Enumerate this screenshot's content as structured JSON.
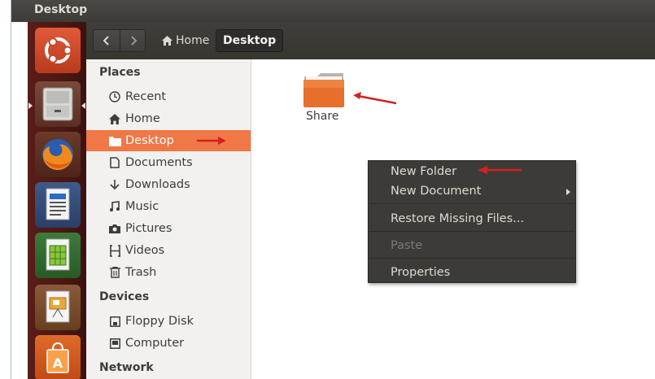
{
  "window": {
    "title": "Desktop"
  },
  "toolbar": {
    "back_icon": "chevron-left-icon",
    "forward_icon": "chevron-right-icon",
    "breadcrumb_home": "Home",
    "breadcrumb_current": "Desktop"
  },
  "launcher": {
    "items": [
      "ubuntu-dash",
      "files",
      "firefox",
      "libreoffice-writer",
      "libreoffice-calc",
      "libreoffice-impress",
      "software-center"
    ]
  },
  "sidebar": {
    "places_title": "Places",
    "places": [
      {
        "label": "Recent",
        "icon": "clock-icon"
      },
      {
        "label": "Home",
        "icon": "home-icon"
      },
      {
        "label": "Desktop",
        "icon": "folder-icon",
        "active": true
      },
      {
        "label": "Documents",
        "icon": "document-icon"
      },
      {
        "label": "Downloads",
        "icon": "download-icon"
      },
      {
        "label": "Music",
        "icon": "music-icon"
      },
      {
        "label": "Pictures",
        "icon": "camera-icon"
      },
      {
        "label": "Videos",
        "icon": "film-icon"
      },
      {
        "label": "Trash",
        "icon": "trash-icon"
      }
    ],
    "devices_title": "Devices",
    "devices": [
      {
        "label": "Floppy Disk",
        "icon": "floppy-icon"
      },
      {
        "label": "Computer",
        "icon": "computer-icon"
      }
    ],
    "network_title": "Network"
  },
  "main": {
    "items": [
      {
        "label": "Share",
        "icon": "folder-icon"
      }
    ]
  },
  "context_menu": {
    "items": [
      {
        "label": "New Folder"
      },
      {
        "label": "New Document",
        "has_submenu": true
      },
      {
        "label": "Restore Missing Files..."
      },
      {
        "label": "Paste",
        "disabled": true
      },
      {
        "label": "Properties"
      }
    ]
  },
  "colors": {
    "accent": "#f07746",
    "titlebar": "#3c3b37",
    "menu_bg": "#3c3b37",
    "annotation_arrow": "#d42020"
  }
}
